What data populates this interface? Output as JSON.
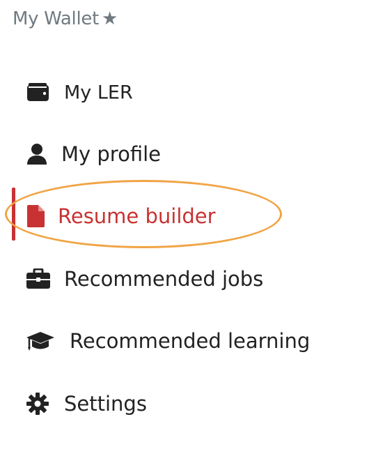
{
  "header": {
    "title": "My Wallet",
    "star_glyph": "★"
  },
  "nav": {
    "items": [
      {
        "label": "My LER",
        "icon": "wallet-icon"
      },
      {
        "label": "My profile",
        "icon": "user-icon"
      },
      {
        "label": "Resume builder",
        "icon": "file-icon",
        "active": true
      },
      {
        "label": "Recommended jobs",
        "icon": "briefcase-icon"
      },
      {
        "label": "Recommended learning",
        "icon": "graduation-cap-icon"
      },
      {
        "label": "Settings",
        "icon": "gear-icon"
      }
    ]
  },
  "colors": {
    "active": "#c83232",
    "text": "#222222",
    "muted": "#707a80",
    "highlight": "#f0a444"
  }
}
